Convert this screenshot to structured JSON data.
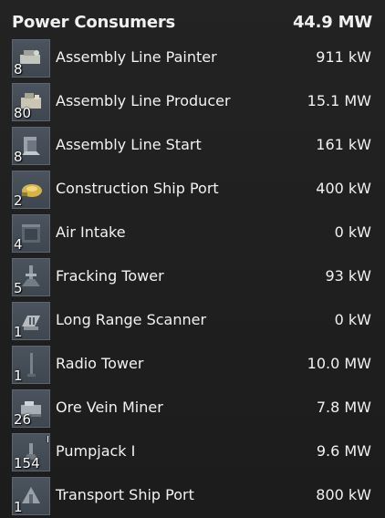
{
  "header": {
    "title": "Power Consumers",
    "total": "44.9 MW"
  },
  "items": [
    {
      "name": "Assembly Line Painter",
      "count": "8",
      "power": "911 kW",
      "icon": "assembly-line-painter-icon",
      "color": "#c2c5bd"
    },
    {
      "name": "Assembly Line Producer",
      "count": "80",
      "power": "15.1 MW",
      "icon": "assembly-line-producer-icon",
      "color": "#c9c6b4"
    },
    {
      "name": "Assembly Line Start",
      "count": "8",
      "power": "161 kW",
      "icon": "assembly-line-start-icon",
      "color": "#9aa1ac"
    },
    {
      "name": "Construction Ship Port",
      "count": "2",
      "power": "400 kW",
      "icon": "construction-ship-port-icon",
      "color": "#d4b44a"
    },
    {
      "name": "Air Intake",
      "count": "4",
      "power": "0 kW",
      "icon": "air-intake-icon",
      "color": "#5c6672"
    },
    {
      "name": "Fracking Tower",
      "count": "5",
      "power": "93 kW",
      "icon": "fracking-tower-icon",
      "color": "#8f979f"
    },
    {
      "name": "Long Range Scanner",
      "count": "1",
      "power": "0 kW",
      "icon": "long-range-scanner-icon",
      "color": "#b7bcc1"
    },
    {
      "name": "Radio Tower",
      "count": "1",
      "power": "10.0 MW",
      "icon": "radio-tower-icon",
      "color": "#7a8089"
    },
    {
      "name": "Ore Vein Miner",
      "count": "26",
      "power": "7.8 MW",
      "icon": "ore-vein-miner-icon",
      "color": "#a8aeb5"
    },
    {
      "name": "Pumpjack I",
      "count": "154",
      "power": "9.6 MW",
      "icon": "pumpjack-icon",
      "color": "#8d949c"
    },
    {
      "name": "Transport Ship Port",
      "count": "1",
      "power": "800 kW",
      "icon": "transport-ship-port-icon",
      "color": "#9aa0a8"
    }
  ]
}
